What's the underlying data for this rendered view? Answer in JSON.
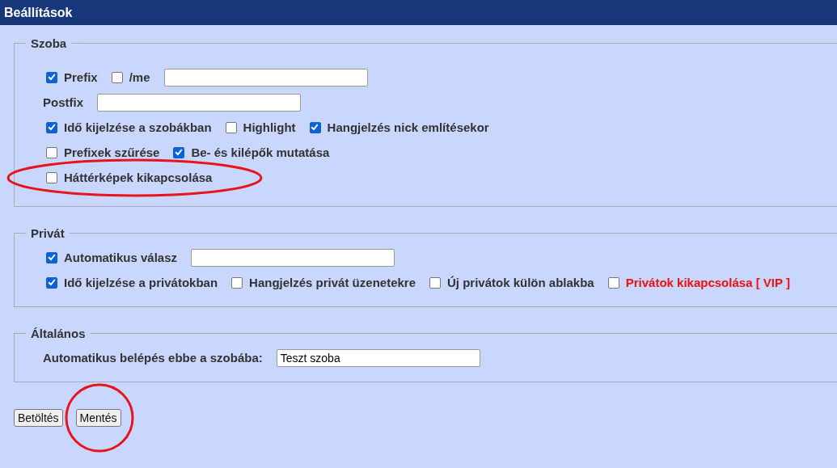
{
  "window": {
    "title": "Beállítások"
  },
  "sections": [
    {
      "legend": "Szoba",
      "lines": [
        [
          {
            "kind": "checkbox",
            "label": "Prefix",
            "checked": true,
            "emphasis": false,
            "circled": false
          },
          {
            "kind": "checkbox",
            "label": "/me",
            "checked": false,
            "emphasis": false,
            "circled": false
          },
          {
            "kind": "input"
          }
        ],
        [
          {
            "kind": "label",
            "text": "Postfix"
          },
          {
            "kind": "input"
          }
        ],
        [
          {
            "kind": "checkbox",
            "label": "Idő kijelzése a szobákban",
            "checked": true,
            "emphasis": false,
            "circled": false
          },
          {
            "kind": "checkbox",
            "label": "Highlight",
            "checked": false,
            "emphasis": false,
            "circled": false
          },
          {
            "kind": "checkbox",
            "label": "Hangjelzés nick említésekor",
            "checked": true,
            "emphasis": false,
            "circled": false
          }
        ],
        [
          {
            "kind": "checkbox",
            "label": "Prefixek szűrése",
            "checked": false,
            "emphasis": false,
            "circled": false
          },
          {
            "kind": "checkbox",
            "label": "Be- és kilépők mutatása",
            "checked": true,
            "emphasis": false,
            "circled": false
          }
        ],
        [
          {
            "kind": "checkbox",
            "label": "Háttérképek kikapcsolása",
            "checked": false,
            "emphasis": false,
            "circled": true
          }
        ]
      ]
    },
    {
      "legend": "Privát",
      "lines": [
        [
          {
            "kind": "checkbox",
            "label": "Automatikus válasz",
            "checked": true,
            "emphasis": false,
            "circled": false
          },
          {
            "kind": "input"
          }
        ],
        [
          {
            "kind": "checkbox",
            "label": "Idő kijelzése a privátokban",
            "checked": true,
            "emphasis": false,
            "circled": false
          },
          {
            "kind": "checkbox",
            "label": "Hangjelzés privát üzenetekre",
            "checked": false,
            "emphasis": false,
            "circled": false
          },
          {
            "kind": "checkbox",
            "label": "Új privátok külön ablakba",
            "checked": false,
            "emphasis": false,
            "circled": false
          },
          {
            "kind": "checkbox",
            "label": "Privátok kikapcsolása [ VIP ]",
            "checked": false,
            "emphasis": true,
            "circled": false
          }
        ]
      ]
    },
    {
      "legend": "Általános",
      "lines": [
        [
          {
            "kind": "label",
            "text": "Automatikus belépés ebbe a szobába:"
          },
          {
            "kind": "input",
            "value": "Teszt szoba"
          }
        ]
      ]
    }
  ],
  "buttons": [
    {
      "label": "Betöltés",
      "circled": false
    },
    {
      "label": "Mentés",
      "circled": true
    }
  ]
}
